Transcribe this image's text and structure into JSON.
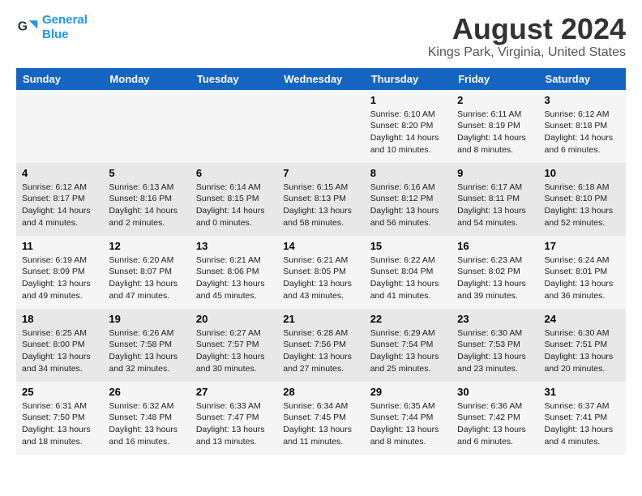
{
  "app": {
    "name_line1": "General",
    "name_line2": "Blue"
  },
  "title": "August 2024",
  "subtitle": "Kings Park, Virginia, United States",
  "colors": {
    "header_bg": "#1565C0",
    "header_text": "#ffffff",
    "odd_row": "#f5f5f5",
    "even_row": "#e8e8e8"
  },
  "days_of_week": [
    "Sunday",
    "Monday",
    "Tuesday",
    "Wednesday",
    "Thursday",
    "Friday",
    "Saturday"
  ],
  "weeks": [
    {
      "days": [
        {
          "num": "",
          "info": ""
        },
        {
          "num": "",
          "info": ""
        },
        {
          "num": "",
          "info": ""
        },
        {
          "num": "",
          "info": ""
        },
        {
          "num": "1",
          "info": "Sunrise: 6:10 AM\nSunset: 8:20 PM\nDaylight: 14 hours and 10 minutes."
        },
        {
          "num": "2",
          "info": "Sunrise: 6:11 AM\nSunset: 8:19 PM\nDaylight: 14 hours and 8 minutes."
        },
        {
          "num": "3",
          "info": "Sunrise: 6:12 AM\nSunset: 8:18 PM\nDaylight: 14 hours and 6 minutes."
        }
      ]
    },
    {
      "days": [
        {
          "num": "4",
          "info": "Sunrise: 6:12 AM\nSunset: 8:17 PM\nDaylight: 14 hours and 4 minutes."
        },
        {
          "num": "5",
          "info": "Sunrise: 6:13 AM\nSunset: 8:16 PM\nDaylight: 14 hours and 2 minutes."
        },
        {
          "num": "6",
          "info": "Sunrise: 6:14 AM\nSunset: 8:15 PM\nDaylight: 14 hours and 0 minutes."
        },
        {
          "num": "7",
          "info": "Sunrise: 6:15 AM\nSunset: 8:13 PM\nDaylight: 13 hours and 58 minutes."
        },
        {
          "num": "8",
          "info": "Sunrise: 6:16 AM\nSunset: 8:12 PM\nDaylight: 13 hours and 56 minutes."
        },
        {
          "num": "9",
          "info": "Sunrise: 6:17 AM\nSunset: 8:11 PM\nDaylight: 13 hours and 54 minutes."
        },
        {
          "num": "10",
          "info": "Sunrise: 6:18 AM\nSunset: 8:10 PM\nDaylight: 13 hours and 52 minutes."
        }
      ]
    },
    {
      "days": [
        {
          "num": "11",
          "info": "Sunrise: 6:19 AM\nSunset: 8:09 PM\nDaylight: 13 hours and 49 minutes."
        },
        {
          "num": "12",
          "info": "Sunrise: 6:20 AM\nSunset: 8:07 PM\nDaylight: 13 hours and 47 minutes."
        },
        {
          "num": "13",
          "info": "Sunrise: 6:21 AM\nSunset: 8:06 PM\nDaylight: 13 hours and 45 minutes."
        },
        {
          "num": "14",
          "info": "Sunrise: 6:21 AM\nSunset: 8:05 PM\nDaylight: 13 hours and 43 minutes."
        },
        {
          "num": "15",
          "info": "Sunrise: 6:22 AM\nSunset: 8:04 PM\nDaylight: 13 hours and 41 minutes."
        },
        {
          "num": "16",
          "info": "Sunrise: 6:23 AM\nSunset: 8:02 PM\nDaylight: 13 hours and 39 minutes."
        },
        {
          "num": "17",
          "info": "Sunrise: 6:24 AM\nSunset: 8:01 PM\nDaylight: 13 hours and 36 minutes."
        }
      ]
    },
    {
      "days": [
        {
          "num": "18",
          "info": "Sunrise: 6:25 AM\nSunset: 8:00 PM\nDaylight: 13 hours and 34 minutes."
        },
        {
          "num": "19",
          "info": "Sunrise: 6:26 AM\nSunset: 7:58 PM\nDaylight: 13 hours and 32 minutes."
        },
        {
          "num": "20",
          "info": "Sunrise: 6:27 AM\nSunset: 7:57 PM\nDaylight: 13 hours and 30 minutes."
        },
        {
          "num": "21",
          "info": "Sunrise: 6:28 AM\nSunset: 7:56 PM\nDaylight: 13 hours and 27 minutes."
        },
        {
          "num": "22",
          "info": "Sunrise: 6:29 AM\nSunset: 7:54 PM\nDaylight: 13 hours and 25 minutes."
        },
        {
          "num": "23",
          "info": "Sunrise: 6:30 AM\nSunset: 7:53 PM\nDaylight: 13 hours and 23 minutes."
        },
        {
          "num": "24",
          "info": "Sunrise: 6:30 AM\nSunset: 7:51 PM\nDaylight: 13 hours and 20 minutes."
        }
      ]
    },
    {
      "days": [
        {
          "num": "25",
          "info": "Sunrise: 6:31 AM\nSunset: 7:50 PM\nDaylight: 13 hours and 18 minutes."
        },
        {
          "num": "26",
          "info": "Sunrise: 6:32 AM\nSunset: 7:48 PM\nDaylight: 13 hours and 16 minutes."
        },
        {
          "num": "27",
          "info": "Sunrise: 6:33 AM\nSunset: 7:47 PM\nDaylight: 13 hours and 13 minutes."
        },
        {
          "num": "28",
          "info": "Sunrise: 6:34 AM\nSunset: 7:45 PM\nDaylight: 13 hours and 11 minutes."
        },
        {
          "num": "29",
          "info": "Sunrise: 6:35 AM\nSunset: 7:44 PM\nDaylight: 13 hours and 8 minutes."
        },
        {
          "num": "30",
          "info": "Sunrise: 6:36 AM\nSunset: 7:42 PM\nDaylight: 13 hours and 6 minutes."
        },
        {
          "num": "31",
          "info": "Sunrise: 6:37 AM\nSunset: 7:41 PM\nDaylight: 13 hours and 4 minutes."
        }
      ]
    }
  ]
}
